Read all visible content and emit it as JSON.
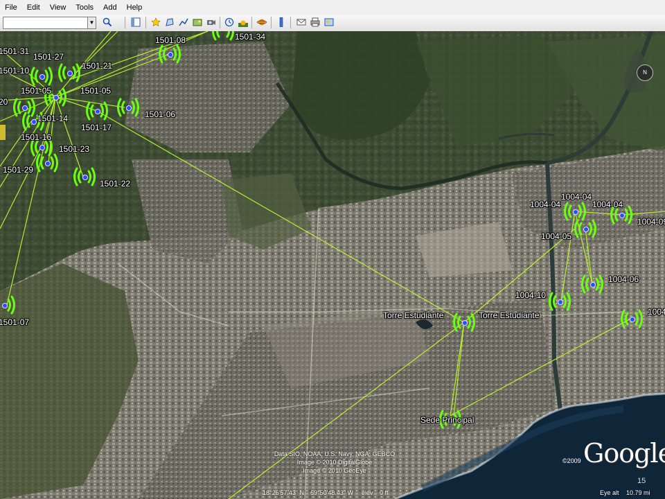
{
  "menu": {
    "items": [
      "File",
      "Edit",
      "View",
      "Tools",
      "Add",
      "Help"
    ]
  },
  "toolbar": {
    "search_value": "",
    "buttons": [
      "sidebar-icon",
      "placemark-icon",
      "polygon-icon",
      "path-icon",
      "image-overlay-icon",
      "tour-icon",
      "historical-imagery-icon",
      "sunlight-icon",
      "planets-icon",
      "ruler-icon",
      "email-icon",
      "print-icon",
      "save-image-icon"
    ]
  },
  "towers": [
    {
      "id": "1501-31",
      "label": "1501-31"
    },
    {
      "id": "1501-27",
      "label": "1501-27"
    },
    {
      "id": "1501-10",
      "label": "1501-10"
    },
    {
      "id": "1501-21",
      "label": "1501-21"
    },
    {
      "id": "1501-05a",
      "label": "1501-05"
    },
    {
      "id": "1501-05b",
      "label": "1501-05"
    },
    {
      "id": "20",
      "label": "20"
    },
    {
      "id": "1501-14",
      "label": "1501-14"
    },
    {
      "id": "1501-17",
      "label": "1501-17"
    },
    {
      "id": "1501-16",
      "label": "1501-16"
    },
    {
      "id": "1501-23",
      "label": "1501-23"
    },
    {
      "id": "1501-29",
      "label": "1501-29"
    },
    {
      "id": "1501-22",
      "label": "1501-22"
    },
    {
      "id": "1501-08",
      "label": "1501-08"
    },
    {
      "id": "1501-34",
      "label": "1501-34"
    },
    {
      "id": "1501-06",
      "label": "1501-06"
    },
    {
      "id": "1501-07",
      "label": "1501-07"
    },
    {
      "id": "1004-04a",
      "label": "1004-04"
    },
    {
      "id": "1004-04b",
      "label": "1004-04"
    },
    {
      "id": "1004-04c",
      "label": "1004-04"
    },
    {
      "id": "1004-09",
      "label": "1004-09"
    },
    {
      "id": "1004-05",
      "label": "1004-05"
    },
    {
      "id": "1004-06",
      "label": "1004-06"
    },
    {
      "id": "1004-10",
      "label": "1004-10"
    },
    {
      "id": "1004",
      "label": "1004"
    },
    {
      "id": "torre-a",
      "label": "Torre Estudiante"
    },
    {
      "id": "torre-b",
      "label": "Torre Estudiante"
    },
    {
      "id": "sede",
      "label": "Sede Principal"
    }
  ],
  "credits": {
    "line1": "Data SIO, NOAA, U.S. Navy, NGA, GEBCO",
    "line2": "Image © 2010 DigitalGlobe",
    "line3": "Image © 2010 GeoEye"
  },
  "google": {
    "copyright": "©2009",
    "logo": "Google"
  },
  "status": {
    "lat": "18°26'57.43\" N",
    "lon": "69°50'48.43\" W",
    "elev_label": "elev",
    "elev": "0 ft",
    "eye_label": "Eye alt",
    "eye_alt": "10.79 mi"
  },
  "compass_label": "N",
  "page_number": "15"
}
